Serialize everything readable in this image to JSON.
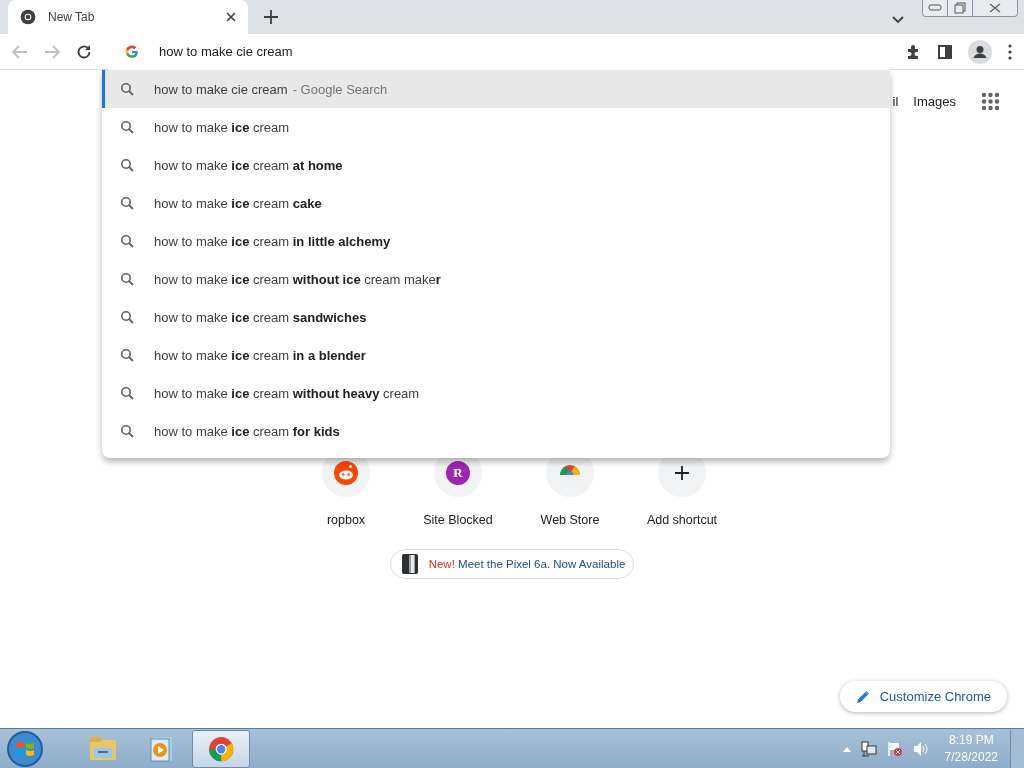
{
  "tabs": [
    {
      "title": "New Tab",
      "selected": true
    }
  ],
  "omnibox": {
    "value": "how to make cie cream"
  },
  "suggestions": [
    {
      "text": "how to make cie cream",
      "suffix": "- Google Search",
      "selected": true
    },
    {
      "text": "how to make **ice** cream",
      "selected": false
    },
    {
      "text": "how to make **ice** cream **at home**",
      "selected": false
    },
    {
      "text": "how to make **ice** cream **cake**",
      "selected": false
    },
    {
      "text": "how to make **ice** cream **in little alchemy**",
      "selected": false
    },
    {
      "text": "how to make **ice** cream **without ice** cream make**r**",
      "selected": false
    },
    {
      "text": "how to make **ice** cream **sandwiches**",
      "selected": false
    },
    {
      "text": "how to make **ice** cream **in a blender**",
      "selected": false
    },
    {
      "text": "how to make **ice** cream **without heavy** cream",
      "selected": false
    },
    {
      "text": "how to make **ice** cream **for kids**",
      "selected": false
    }
  ],
  "top_links": [
    "il",
    "Images"
  ],
  "shortcuts": [
    {
      "kind": "reddit",
      "label": "ropbox"
    },
    {
      "kind": "letter",
      "letter": "R",
      "label": "Site Blocked"
    },
    {
      "kind": "webstore",
      "label": "Web Store"
    },
    {
      "kind": "add",
      "label": "Add shortcut"
    }
  ],
  "promo": {
    "badge": "New!",
    "text": "Meet the Pixel 6a. Now Available"
  },
  "customize": {
    "label": "Customize Chrome"
  },
  "taskbar": {
    "apps": [
      {
        "kind": "explorer",
        "active": false
      },
      {
        "kind": "media",
        "active": false
      },
      {
        "kind": "chrome",
        "active": true
      }
    ],
    "clock": {
      "time": "8:19 PM",
      "date": "7/28/2022"
    }
  }
}
